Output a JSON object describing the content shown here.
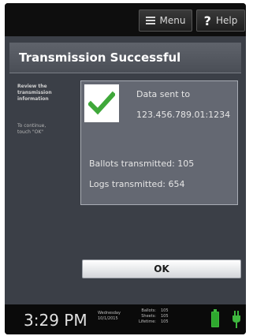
{
  "topbar": {
    "menu_label": "Menu",
    "help_label": "Help",
    "help_symbol": "?"
  },
  "panel": {
    "title": "Transmission Successful",
    "sidebar": {
      "instruction_lines": [
        "Review the",
        "transmission",
        "information"
      ],
      "continue_lines": [
        "To continue,",
        "touch \"OK\""
      ]
    },
    "content": {
      "data_sent_label": "Data sent to",
      "data_sent_address": "123.456.789.01:1234",
      "ballots_transmitted": "Ballots transmitted: 105",
      "logs_transmitted": "Logs transmitted: 654"
    },
    "ok_label": "OK"
  },
  "statusbar": {
    "time": "3:29 PM",
    "date_lines": [
      "Wednesday",
      "10/1/2015"
    ],
    "counters": [
      {
        "label": "Ballots:",
        "value": "105"
      },
      {
        "label": "Sheets:",
        "value": "105"
      },
      {
        "label": "Lifetime:",
        "value": "105"
      }
    ]
  },
  "colors": {
    "check_green": "#3fa83a",
    "battery_green": "#2ea82e",
    "panel_bg": "#3b3f47",
    "content_bg": "#646872"
  },
  "icons": {
    "menu": "menu-icon",
    "help": "help-icon",
    "check": "checkmark-icon",
    "battery": "battery-icon",
    "power": "power-plug-icon"
  }
}
